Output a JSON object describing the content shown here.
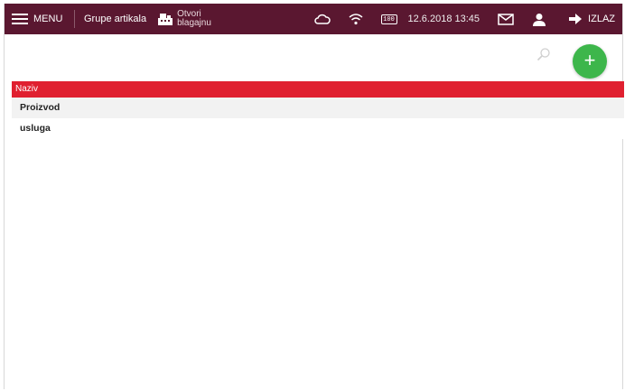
{
  "topbar": {
    "menu_label": "MENU",
    "title": "Grupe artikala",
    "open_register_line1": "Otvori",
    "open_register_line2": "blagajnu",
    "battery_level": "100",
    "datetime": "12.6.2018 13:45",
    "exit_label": "IZLAZ"
  },
  "colors": {
    "topbar": "#5a1730",
    "header": "#e02030",
    "add_button": "#3db64b"
  },
  "toolbar": {
    "add_symbol": "+"
  },
  "table": {
    "columns": [
      "Naziv"
    ],
    "rows": [
      {
        "name": "Proizvod"
      },
      {
        "name": "usluga"
      }
    ]
  }
}
